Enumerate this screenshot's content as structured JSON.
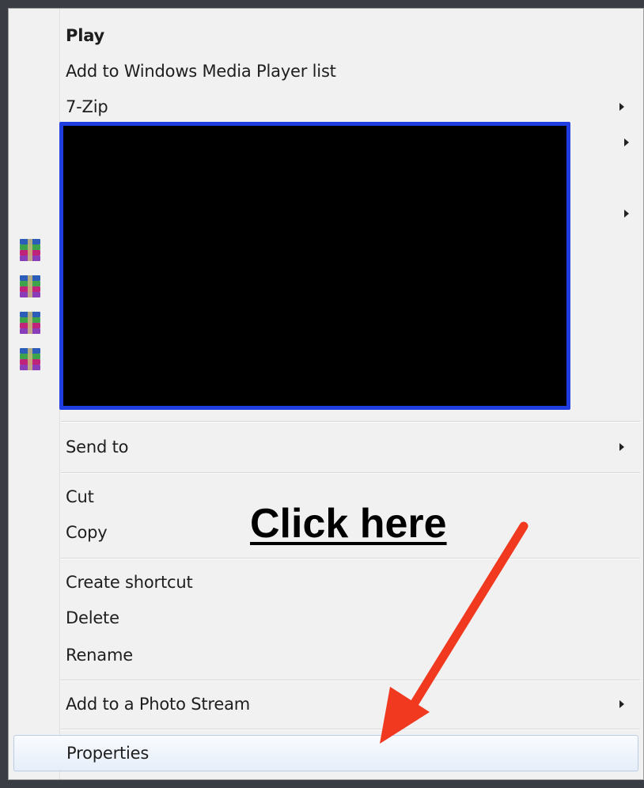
{
  "menu": {
    "items_top": [
      {
        "label": "Play",
        "bold": true,
        "submenu": false
      },
      {
        "label": "Add to Windows Media Player list",
        "bold": false,
        "submenu": false
      },
      {
        "label": "7-Zip",
        "bold": false,
        "submenu": true
      }
    ],
    "send_to": {
      "label": "Send to",
      "submenu": true
    },
    "clipboard": [
      {
        "label": "Cut"
      },
      {
        "label": "Copy"
      }
    ],
    "file_ops": [
      {
        "label": "Create shortcut"
      },
      {
        "label": "Delete"
      },
      {
        "label": "Rename"
      }
    ],
    "photo_stream": {
      "label": "Add to a Photo Stream",
      "submenu": true
    },
    "properties": {
      "label": "Properties",
      "highlighted": true
    },
    "redacted_region": {
      "color": "#000000",
      "border_color": "#1f3de0"
    },
    "rar_icons": [
      "winrar-icon",
      "winrar-icon",
      "winrar-icon",
      "winrar-icon"
    ]
  },
  "annotation": {
    "text": "Click here",
    "arrow_color": "#f0391e"
  },
  "colors": {
    "menu_background": "#f1f1f1",
    "highlight_border": "#b9cde8",
    "page_background": "#3a3d44"
  }
}
